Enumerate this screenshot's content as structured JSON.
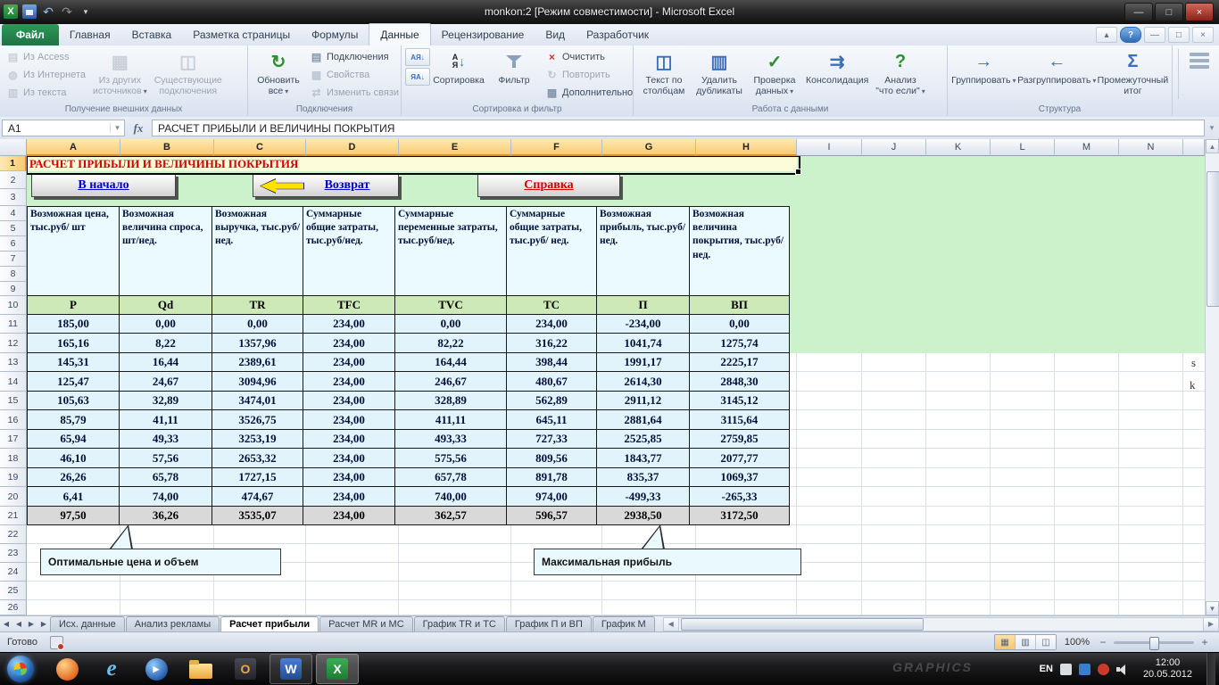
{
  "window": {
    "title": "monkon:2  [Режим совместимости]  -  Microsoft Excel"
  },
  "tabs": {
    "file": "Файл",
    "items": [
      "Главная",
      "Вставка",
      "Разметка страницы",
      "Формулы",
      "Данные",
      "Рецензирование",
      "Вид",
      "Разработчик"
    ],
    "active": "Данные"
  },
  "ribbon": {
    "groups": [
      {
        "label": "Получение внешних данных",
        "items": [
          {
            "label": "Из Access",
            "size": "small",
            "icon": "access",
            "disabled": true
          },
          {
            "label": "Из Интернета",
            "size": "small",
            "icon": "web",
            "disabled": true
          },
          {
            "label": "Из текста",
            "size": "small",
            "icon": "textfile",
            "disabled": true
          },
          {
            "label": "Из других источников",
            "lines": [
              "Из других",
              "источников"
            ],
            "size": "large",
            "icon": "sources",
            "dropdown": true,
            "disabled": true
          },
          {
            "label": "Существующие подключения",
            "lines": [
              "Существующие",
              "подключения"
            ],
            "size": "large",
            "icon": "existing",
            "disabled": true
          }
        ]
      },
      {
        "label": "Подключения",
        "items": [
          {
            "label": "Обновить все",
            "lines": [
              "Обновить",
              "все"
            ],
            "size": "large",
            "icon": "refresh",
            "dropdown": true
          },
          {
            "label": "Подключения",
            "size": "small",
            "icon": "connections"
          },
          {
            "label": "Свойства",
            "size": "small",
            "icon": "props",
            "disabled": true
          },
          {
            "label": "Изменить связи",
            "size": "small",
            "icon": "links",
            "disabled": true
          }
        ]
      },
      {
        "label": "Сортировка и фильтр",
        "items": [
          {
            "label": "",
            "size": "tiny",
            "icon": "sortaz"
          },
          {
            "label": "",
            "size": "tiny",
            "icon": "sortza"
          },
          {
            "label": "Сортировка",
            "lines": [
              "Сортировка"
            ],
            "size": "large",
            "icon": "sort"
          },
          {
            "label": "Фильтр",
            "lines": [
              "Фильтр"
            ],
            "size": "large",
            "icon": "filter"
          },
          {
            "label": "Очистить",
            "size": "small",
            "icon": "clear"
          },
          {
            "label": "Повторить",
            "size": "small",
            "icon": "reapply",
            "disabled": true
          },
          {
            "label": "Дополнительно",
            "size": "small",
            "icon": "advanced"
          }
        ]
      },
      {
        "label": "Работа с данными",
        "items": [
          {
            "label": "Текст по столбцам",
            "lines": [
              "Текст по",
              "столбцам"
            ],
            "size": "large",
            "icon": "cols"
          },
          {
            "label": "Удалить дубликаты",
            "lines": [
              "Удалить",
              "дубликаты"
            ],
            "size": "large",
            "icon": "dupes"
          },
          {
            "label": "Проверка данных",
            "lines": [
              "Проверка",
              "данных"
            ],
            "size": "large",
            "icon": "valid",
            "dropdown": true
          },
          {
            "label": "Консолидация",
            "lines": [
              "Консолидация"
            ],
            "size": "large",
            "icon": "consol"
          },
          {
            "label": "Анализ \"что если\"",
            "lines": [
              "Анализ",
              "\"что если\""
            ],
            "size": "large",
            "icon": "whatif",
            "dropdown": true
          }
        ]
      },
      {
        "label": "Структура",
        "items": [
          {
            "label": "Группировать",
            "lines": [
              "Группировать"
            ],
            "size": "large",
            "icon": "group",
            "dropdown": true
          },
          {
            "label": "Разгруппировать",
            "lines": [
              "Разгруппировать"
            ],
            "size": "large",
            "icon": "ungroup",
            "dropdown": true
          },
          {
            "label": "Промежуточный итог",
            "lines": [
              "Промежуточный",
              "итог"
            ],
            "size": "large",
            "icon": "subtotal"
          }
        ]
      }
    ]
  },
  "formula_bar": {
    "name_box": "A1",
    "fx": "fx",
    "formula": "РАСЧЕТ ПРИБЫЛИ И ВЕЛИЧИНЫ ПОКРЫТИЯ"
  },
  "grid": {
    "columns": [
      "A",
      "B",
      "C",
      "D",
      "E",
      "F",
      "G",
      "H",
      "I",
      "J",
      "K",
      "L",
      "M",
      "N"
    ],
    "selected_columns": [
      "A",
      "B",
      "C",
      "D",
      "E",
      "F",
      "G",
      "H"
    ],
    "selected_row": 1,
    "title_cell": "РАСЧЕТ ПРИБЫЛИ И ВЕЛИЧИНЫ ПОКРЫТИЯ",
    "buttons": [
      {
        "label": "В начало",
        "color": "#0000cc",
        "arrow": false
      },
      {
        "label": "Возврат",
        "color": "#0000cc",
        "arrow": true
      },
      {
        "label": "Справка",
        "color": "#cc0000",
        "arrow": false
      }
    ],
    "table": {
      "headers": [
        "Возможная цена,  тыс.руб/ шт",
        "Возможная величина спроса, шт/нед.",
        "Возможная выручка, тыс.руб/ нед.",
        "Суммарные общие затраты, тыс.руб/нед.",
        "Суммарные переменные затраты, тыс.руб/нед.",
        "Суммарные общие затраты, тыс.руб/ нед.",
        "Возможная прибыль, тыс.руб/ нед.",
        "Возможная величина покрытия, тыс.руб/нед."
      ],
      "codes": [
        "P",
        "Qd",
        "TR",
        "TFC",
        "TVC",
        "TC",
        "П",
        "ВП"
      ],
      "rows": [
        [
          "185,00",
          "0,00",
          "0,00",
          "234,00",
          "0,00",
          "234,00",
          "-234,00",
          "0,00"
        ],
        [
          "165,16",
          "8,22",
          "1357,96",
          "234,00",
          "82,22",
          "316,22",
          "1041,74",
          "1275,74"
        ],
        [
          "145,31",
          "16,44",
          "2389,61",
          "234,00",
          "164,44",
          "398,44",
          "1991,17",
          "2225,17"
        ],
        [
          "125,47",
          "24,67",
          "3094,96",
          "234,00",
          "246,67",
          "480,67",
          "2614,30",
          "2848,30"
        ],
        [
          "105,63",
          "32,89",
          "3474,01",
          "234,00",
          "328,89",
          "562,89",
          "2911,12",
          "3145,12"
        ],
        [
          "85,79",
          "41,11",
          "3526,75",
          "234,00",
          "411,11",
          "645,11",
          "2881,64",
          "3115,64"
        ],
        [
          "65,94",
          "49,33",
          "3253,19",
          "234,00",
          "493,33",
          "727,33",
          "2525,85",
          "2759,85"
        ],
        [
          "46,10",
          "57,56",
          "2653,32",
          "234,00",
          "575,56",
          "809,56",
          "1843,77",
          "2077,77"
        ],
        [
          "26,26",
          "65,78",
          "1727,15",
          "234,00",
          "657,78",
          "891,78",
          "835,37",
          "1069,37"
        ],
        [
          "6,41",
          "74,00",
          "474,67",
          "234,00",
          "740,00",
          "974,00",
          "-499,33",
          "-265,33"
        ]
      ],
      "summary": [
        "97,50",
        "36,26",
        "3535,07",
        "234,00",
        "362,57",
        "596,57",
        "2938,50",
        "3172,50"
      ]
    },
    "callouts": [
      {
        "text": "Оптимальные  цена и объем"
      },
      {
        "text": "Максимальная прибыль"
      }
    ],
    "stray_text": [
      "s",
      "k"
    ]
  },
  "sheet_tabs": {
    "items": [
      "Исх. данные",
      "Анализ рекламы",
      "Расчет прибыли",
      "Расчет MR и MC",
      "График TR и ТС",
      "График П и ВП",
      "График M"
    ],
    "active": "Расчет прибыли"
  },
  "status": {
    "ready": "Готово",
    "zoom": "100%"
  },
  "taskbar": {
    "apps": [
      {
        "name": "launcher-orange"
      },
      {
        "name": "internet-explorer",
        "glyph": "e"
      },
      {
        "name": "media-player",
        "glyph": "▶"
      },
      {
        "name": "explorer-folder"
      },
      {
        "name": "outlook",
        "glyph": "O",
        "running": false
      },
      {
        "name": "word",
        "glyph": "W",
        "running": true
      },
      {
        "name": "excel",
        "glyph": "X",
        "running": true,
        "active": true
      }
    ],
    "tray": {
      "lang": "EN",
      "time": "12:00",
      "date": "20.05.2012"
    },
    "watermark": "GRAPHICS"
  },
  "colors": {
    "file_tab_green": "#1f7244",
    "sheet_green": "#cbf2cb",
    "table_fill": "#e2f4fb",
    "code_row_fill": "#cde9b8",
    "summary_fill": "#d9d9d9",
    "title_text_red": "#d40000"
  }
}
